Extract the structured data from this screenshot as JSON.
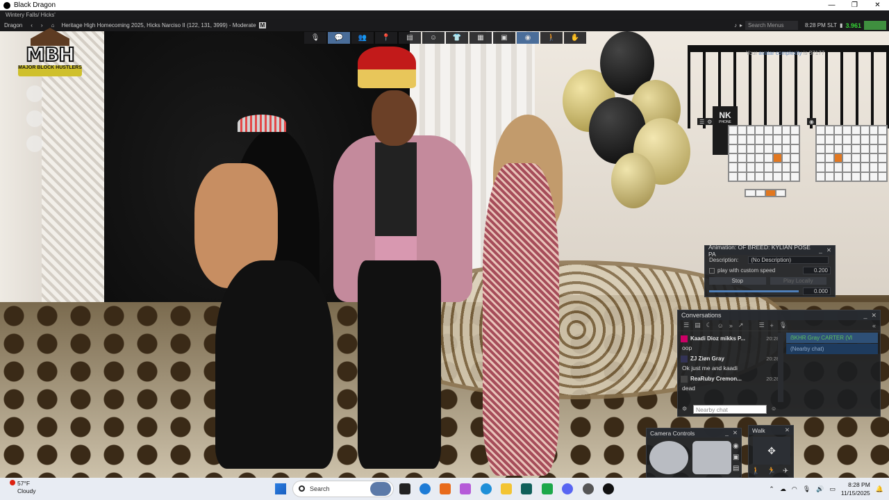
{
  "window": {
    "title": "Black Dragon",
    "minimize": "—",
    "maximize": "❐",
    "close": "✕"
  },
  "sub_bar": {
    "text": "Wintery Falls/ Hicks'"
  },
  "menu_bar": {
    "menu_label": "Dragon",
    "location": "Heritage High Homecoming 2025, Hicks Narciso II (122, 131, 3999) - Moderate",
    "rating_badge": "M",
    "search_placeholder": "Search Menus",
    "time": "8:28 PM SLT",
    "fps": "3.961"
  },
  "toolbar": {
    "buttons": [
      "chat",
      "people",
      "places",
      "inventory",
      "appearance",
      "outfits",
      "build",
      "snapshot",
      "camera",
      "walk",
      "gestures"
    ]
  },
  "complexity": {
    "prefix": "Your",
    "link": "avatar complexity",
    "suffix": "is 87177"
  },
  "logo": {
    "big": "MBH",
    "small": "MAJOR BLOCK HUSTLERS"
  },
  "nk_box": {
    "big": "NK",
    "small": "PHONE"
  },
  "anim_panel": {
    "title": "Animation: OF BREED: KYLIAN POSE PA",
    "description_label": "Description:",
    "description_value": "(No Description)",
    "custom_speed_label": "play with custom speed",
    "speed_value": "0.200",
    "stop_label": "Stop",
    "play_locally_label": "Play Locally",
    "slider_value": "0.000"
  },
  "conversations": {
    "title": "Conversations",
    "messages": [
      {
        "name": "Kaadi Dioz mikks P...",
        "time": "20:28",
        "text": "oop"
      },
      {
        "name": "ZJ Ziøn Gray",
        "time": "20:28",
        "text": "Ok just me and kaadi"
      },
      {
        "name": "ReaRuby Cremon...",
        "time": "20:28",
        "text": "dead"
      }
    ],
    "input_placeholder": "Nearby chat",
    "list": [
      {
        "label": "ẞKHR Gray CARTER (Ⅵ"
      },
      {
        "label": "(Nearby chat)"
      }
    ]
  },
  "camera_controls": {
    "title": "Camera Controls"
  },
  "walk": {
    "title": "Walk"
  },
  "taskbar": {
    "weather_temp": "57°F",
    "weather_desc": "Cloudy",
    "search_label": "Search",
    "time": "8:28 PM",
    "date": "11/15/2025"
  }
}
